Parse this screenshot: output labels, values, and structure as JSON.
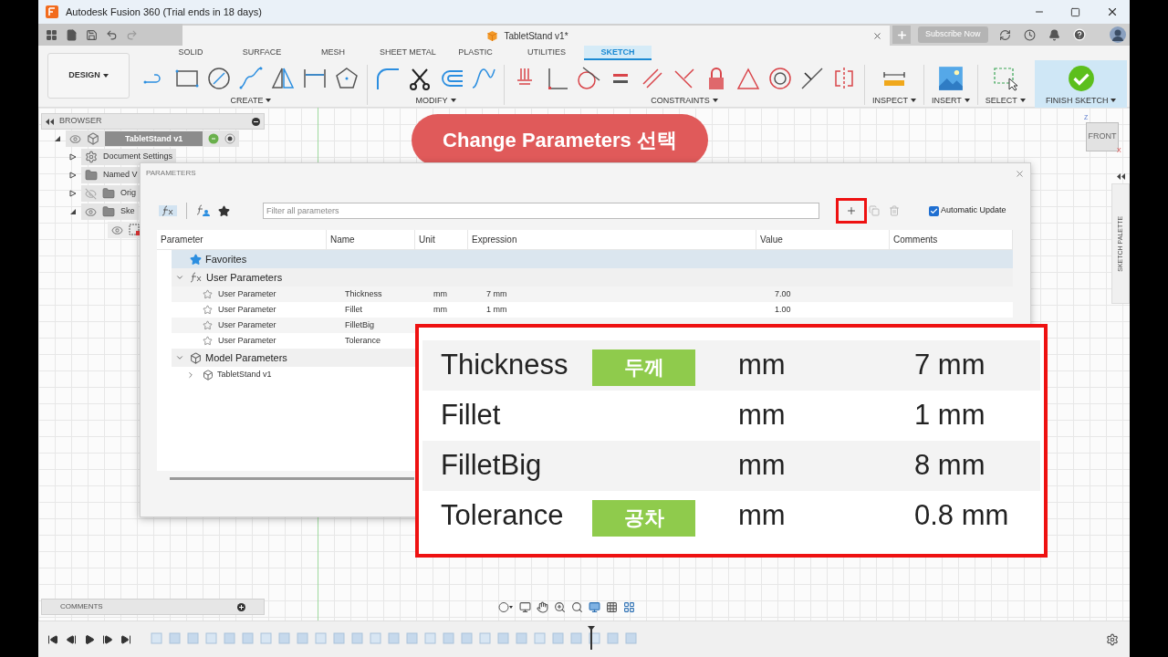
{
  "window": {
    "title": "Autodesk Fusion 360 (Trial ends in 18 days)"
  },
  "document_tab": {
    "title": "TabletStand v1*"
  },
  "subscribe_button": "Subscribe Now",
  "workspace_button": "DESIGN",
  "ribbon_tabs": [
    {
      "label": "SOLID",
      "selected": false
    },
    {
      "label": "SURFACE",
      "selected": false
    },
    {
      "label": "MESH",
      "selected": false
    },
    {
      "label": "SHEET METAL",
      "selected": false
    },
    {
      "label": "PLASTIC",
      "selected": false
    },
    {
      "label": "UTILITIES",
      "selected": false
    },
    {
      "label": "SKETCH",
      "selected": true
    }
  ],
  "tool_groups": [
    {
      "label": "CREATE",
      "kind": "tools"
    },
    {
      "label": "MODIFY",
      "kind": "tools"
    },
    {
      "label": "CONSTRAINTS",
      "kind": "tools"
    },
    {
      "label": "INSPECT",
      "kind": "tools"
    },
    {
      "label": "INSERT",
      "kind": "tools"
    },
    {
      "label": "SELECT",
      "kind": "tools"
    },
    {
      "label": "FINISH SKETCH",
      "kind": "finish"
    }
  ],
  "browser": {
    "title": "BROWSER",
    "items": [
      {
        "label": "TabletStand v1",
        "kind": "component",
        "expanded": true,
        "visible": true,
        "children": [
          {
            "label": "Document Settings",
            "kind": "settings",
            "expanded": false
          },
          {
            "label": "Named V",
            "kind": "folder",
            "expanded": false
          },
          {
            "label": "Orig",
            "kind": "folder",
            "expanded": false,
            "visible": false
          },
          {
            "label": "Ske",
            "kind": "folder",
            "expanded": true,
            "visible": true,
            "children": [
              {
                "kind": "sketch",
                "visible": true
              }
            ]
          }
        ]
      }
    ]
  },
  "banner": "Change Parameters 선택",
  "parameters_dialog": {
    "title": "PARAMETERS",
    "filter_placeholder": "Filter all parameters",
    "automatic_update": {
      "label": "Automatic Update",
      "checked": true
    },
    "columns": [
      "Parameter",
      "Name",
      "Unit",
      "Expression",
      "Value",
      "Comments"
    ],
    "groups": [
      {
        "kind": "favorites",
        "label": "Favorites"
      },
      {
        "kind": "user",
        "label": "User Parameters",
        "expanded": true,
        "rows": [
          {
            "parameter": "User Parameter",
            "name": "Thickness",
            "unit": "mm",
            "expression": "7 mm",
            "value": "7.00"
          },
          {
            "parameter": "User Parameter",
            "name": "Fillet",
            "unit": "mm",
            "expression": "1 mm",
            "value": "1.00"
          },
          {
            "parameter": "User Parameter",
            "name": "FilletBig"
          },
          {
            "parameter": "User Parameter",
            "name": "Tolerance"
          }
        ]
      },
      {
        "kind": "model",
        "label": "Model Parameters",
        "expanded": true,
        "rows": [
          {
            "name": "TabletStand v1"
          }
        ]
      }
    ]
  },
  "callout": {
    "rows": [
      {
        "name": "Thickness",
        "tag": "두께",
        "unit": "mm",
        "expression": "7 mm"
      },
      {
        "name": "Fillet",
        "unit": "mm",
        "expression": "1 mm"
      },
      {
        "name": "FilletBig",
        "unit": "mm",
        "expression": "8 mm"
      },
      {
        "name": "Tolerance",
        "tag": "공차",
        "unit": "mm",
        "expression": "0.8 mm"
      }
    ]
  },
  "view_cube": {
    "face": "FRONT",
    "axis_z": "Z",
    "axis_x": "X"
  },
  "sketch_palette": "SKETCH PALETTE",
  "comments_panel": {
    "title": "COMMENTS"
  }
}
